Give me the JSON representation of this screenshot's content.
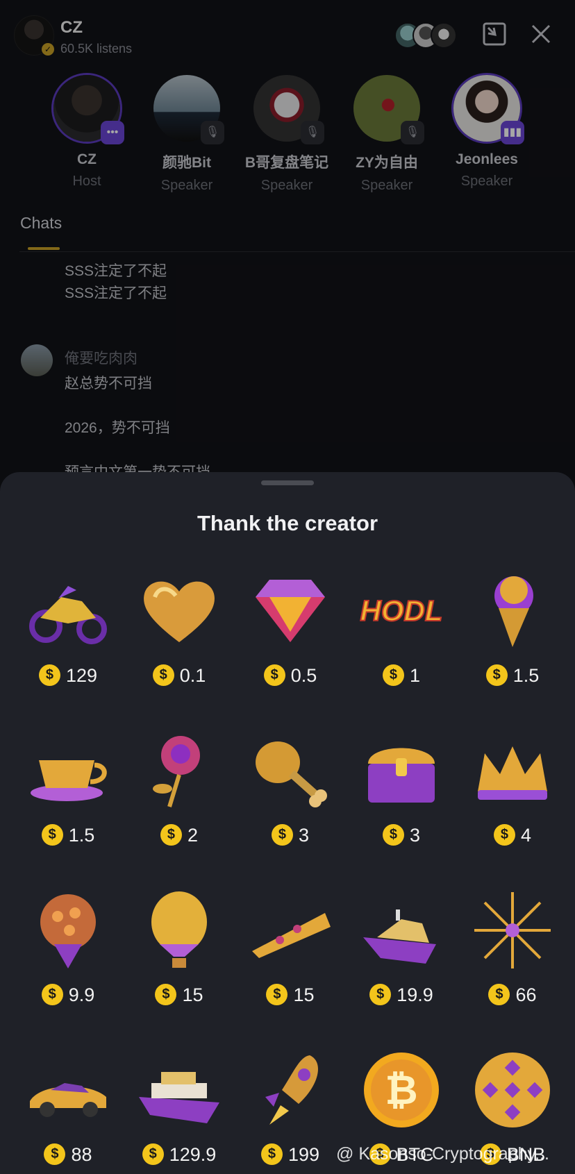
{
  "header": {
    "host_name": "CZ",
    "listens": "60.5K listens"
  },
  "speakers": [
    {
      "name": "CZ",
      "role": "Host",
      "badge": "more",
      "ring": true
    },
    {
      "name": "颜驰Bit",
      "role": "Speaker",
      "badge": "muted",
      "ring": false
    },
    {
      "name": "B哥复盘笔记",
      "role": "Speaker",
      "badge": "muted",
      "ring": false
    },
    {
      "name": "ZY为自由",
      "role": "Speaker",
      "badge": "muted",
      "ring": false
    },
    {
      "name": "Jeonlees",
      "role": "Speaker",
      "badge": "speaking",
      "ring": true
    }
  ],
  "tabs": {
    "chats": "Chats"
  },
  "chat": {
    "prev_lines": [
      "SSS注定了不起",
      "SSS注定了不起"
    ],
    "username": "俺要吃肉肉",
    "lines": [
      "赵总势不可挡",
      "2026，势不可挡",
      "预言中文第一势不可挡"
    ]
  },
  "sheet": {
    "title": "Thank the creator",
    "currency_symbol": "$",
    "gifts": [
      {
        "icon": "motorcycle-icon",
        "price": "129"
      },
      {
        "icon": "heart-icon",
        "price": "0.1"
      },
      {
        "icon": "diamond-icon",
        "price": "0.5"
      },
      {
        "icon": "hodl-icon",
        "price": "1"
      },
      {
        "icon": "ice-cream-icon",
        "price": "1.5"
      },
      {
        "icon": "teacup-icon",
        "price": "1.5"
      },
      {
        "icon": "rose-icon",
        "price": "2"
      },
      {
        "icon": "drumstick-icon",
        "price": "3"
      },
      {
        "icon": "treasure-chest-icon",
        "price": "3"
      },
      {
        "icon": "crown-icon",
        "price": "4"
      },
      {
        "icon": "bouquet-icon",
        "price": "9.9"
      },
      {
        "icon": "hot-air-balloon-icon",
        "price": "15"
      },
      {
        "icon": "pizza-icon",
        "price": "15"
      },
      {
        "icon": "yacht-icon",
        "price": "19.9"
      },
      {
        "icon": "fireworks-icon",
        "price": "66"
      },
      {
        "icon": "sports-car-icon",
        "price": "88"
      },
      {
        "icon": "cruise-ship-icon",
        "price": "129.9"
      },
      {
        "icon": "rocket-icon",
        "price": "199"
      },
      {
        "icon": "btc-coin-icon",
        "price": "BTC"
      },
      {
        "icon": "bnb-coin-icon",
        "price": "BNB"
      }
    ]
  },
  "watermark": "@ Kasonso-Cryptography...",
  "colors": {
    "gold": "#f3c51b",
    "purple": "#6b45d6",
    "sheet_bg": "#1f2128"
  }
}
